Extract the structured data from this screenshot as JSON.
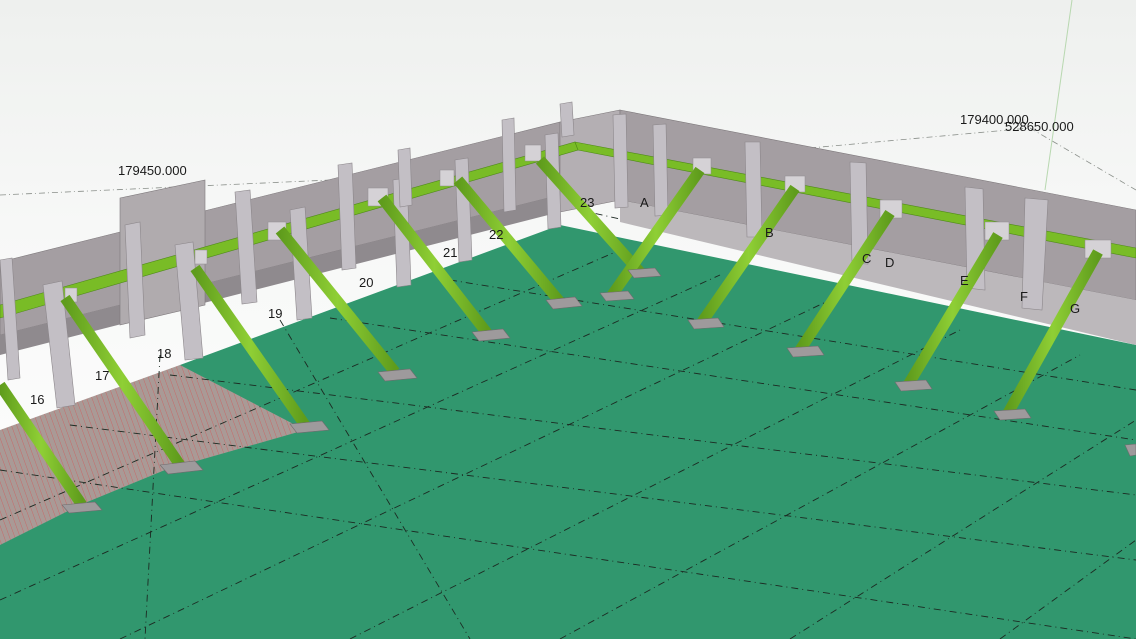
{
  "coordinates": {
    "left_elevation": "179450.000",
    "right_elevation": "179400.000",
    "right_northing": "528650.000"
  },
  "grid_labels": {
    "numbers": [
      "16",
      "17",
      "18",
      "19",
      "20",
      "21",
      "22",
      "23"
    ],
    "letters": [
      "A",
      "B",
      "C",
      "D",
      "E",
      "F",
      "G"
    ]
  },
  "colors": {
    "slab": "#31976e",
    "slab_hatch_area": "#a58a88",
    "wall": "#a49ea2",
    "column": "#c3bfc5",
    "steel_beam": "#79bc26",
    "grid_line": "#1c2a22"
  }
}
